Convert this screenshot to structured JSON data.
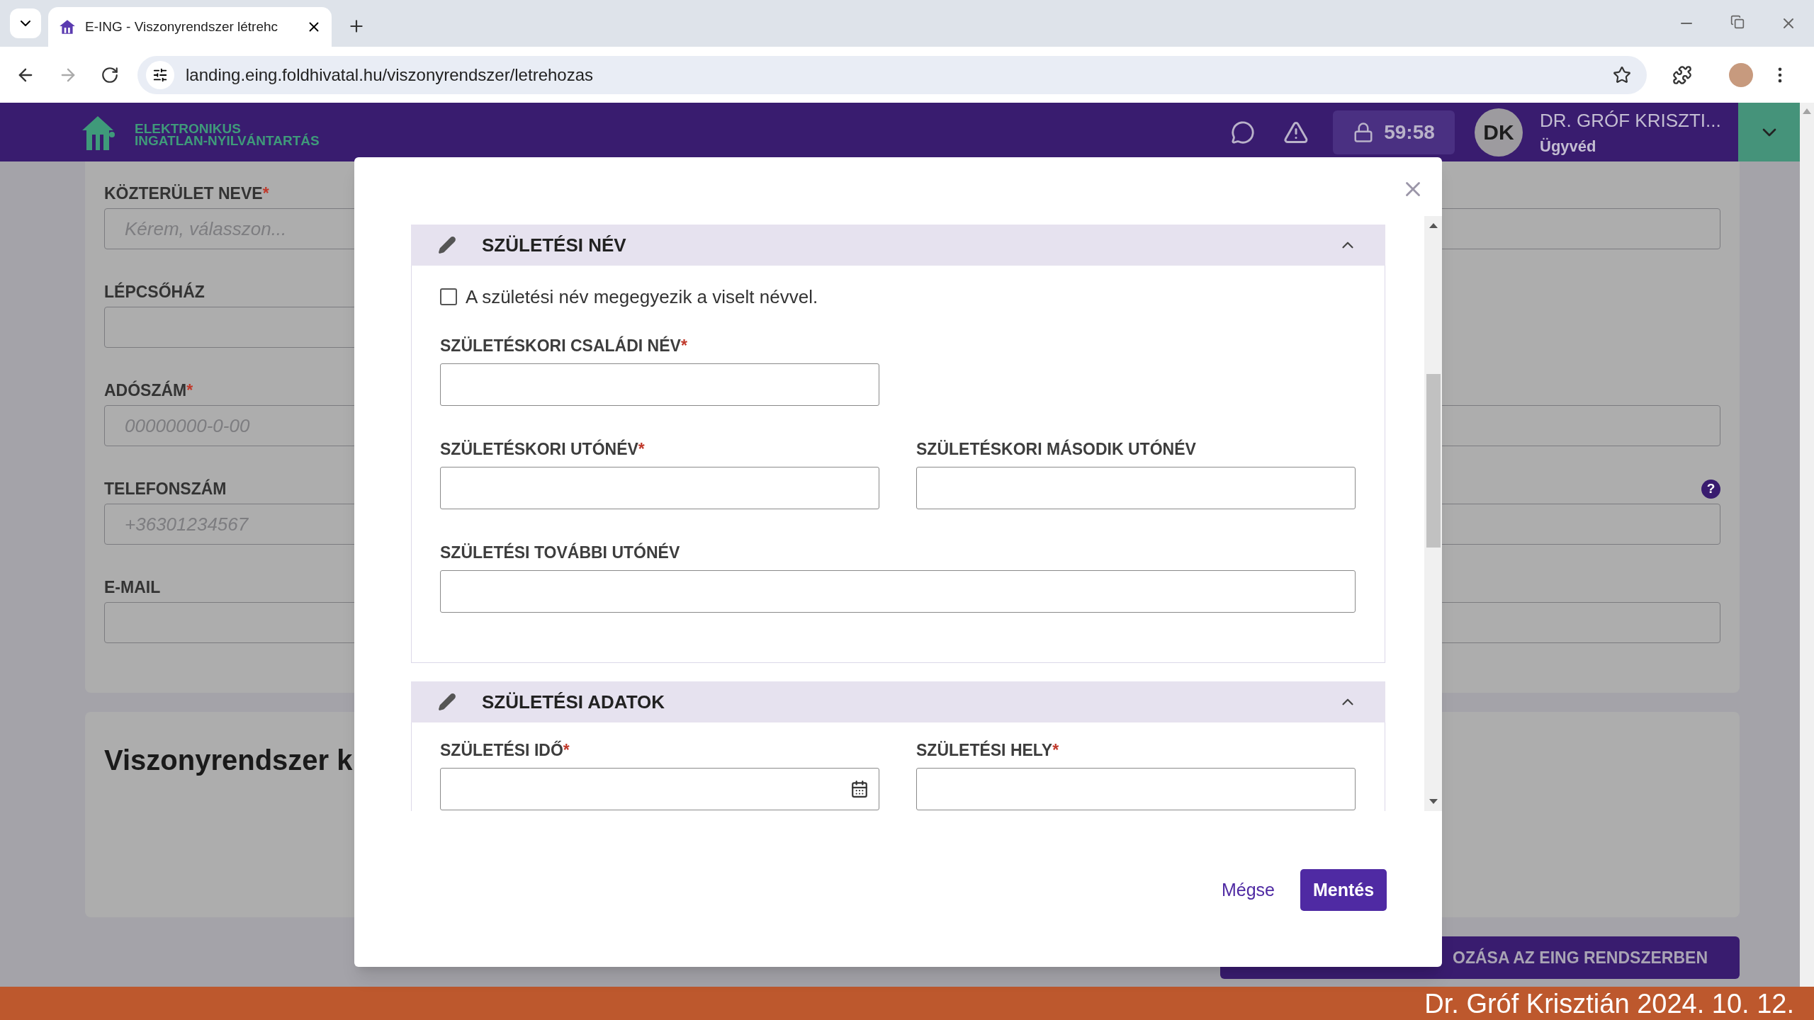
{
  "browser": {
    "tab_title": "E-ING - Viszonyrendszer létrehc",
    "url": "landing.eing.foldhivatal.hu/viszonyrendszer/letrehozas"
  },
  "header": {
    "logo_lines": [
      "ELEKTRONIKUS",
      "INGATLAN-NYILVÁNTARTÁS"
    ],
    "timer": "59:58",
    "avatar_initials": "DK",
    "user_name": "DR. GRÓF KRISZTI...",
    "user_role": "Ügyvéd"
  },
  "background_form": {
    "rows": [
      {
        "label": "KÖZTERÜLET NEVE",
        "required_mark": "*",
        "placeholder": "Kérem, válasszon...",
        "right_field": true
      },
      {
        "label": "LÉPCSŐHÁZ",
        "right_field": false
      },
      {
        "label": "ADÓSZÁM",
        "required_mark": "*",
        "placeholder": "00000000-0-00",
        "right_field": true
      },
      {
        "label": "TELEFONSZÁM",
        "placeholder": "+36301234567",
        "right_field": true,
        "help": "?"
      },
      {
        "label": "E-MAIL",
        "right_field": true
      }
    ],
    "section_title": "Viszonyrendszer k",
    "submit_button": "OZÁSA AZ EING RENDSZERBEN"
  },
  "modal": {
    "sections": [
      {
        "title": "SZÜLETÉSI NÉV",
        "expanded": true,
        "checkbox": {
          "label": "A születési név megegyezik a viselt névvel.",
          "checked": false
        },
        "rows": [
          [
            {
              "label": "SZÜLETÉSKORI CSALÁDI NÉV",
              "required_mark": "*",
              "kind": "text"
            }
          ],
          [
            {
              "label": "SZÜLETÉSKORI UTÓNÉV",
              "required_mark": "*",
              "kind": "text"
            },
            {
              "label": "SZÜLETÉSKORI MÁSODIK UTÓNÉV",
              "kind": "text"
            }
          ],
          [
            {
              "label": "SZÜLETÉSI TOVÁBBI UTÓNÉV",
              "kind": "wide"
            }
          ]
        ]
      },
      {
        "title": "SZÜLETÉSI ADATOK",
        "expanded": true,
        "rows": [
          [
            {
              "label": "SZÜLETÉSI IDŐ",
              "required_mark": "*",
              "kind": "date"
            },
            {
              "label": "SZÜLETÉSI HELY",
              "required_mark": "*",
              "kind": "text"
            }
          ]
        ]
      }
    ],
    "cancel_button": "Mégse",
    "save_button": "Mentés"
  },
  "footer_caption": "Dr. Gróf Krisztián 2024. 10. 12."
}
